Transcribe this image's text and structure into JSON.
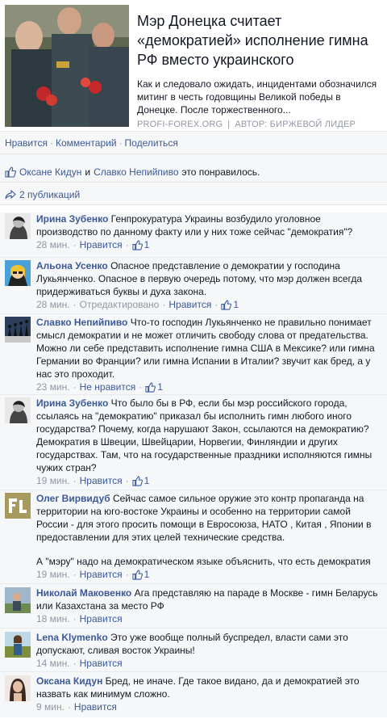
{
  "article": {
    "title": "Мэр Донецка считает «демократией» исполнение гимна РФ вместо украинского",
    "description": "Как и следовало ожидать, инцидентами обозначился митинг в честь годовщины Великой победы в Донецке. После торжественного...",
    "source": "PROFI-FOREX.ORG",
    "author": "АВТОР: БИРЖЕВОЙ ЛИДЕР"
  },
  "actions": {
    "like": "Нравится",
    "comment": "Комментарий",
    "share": "Поделиться"
  },
  "likes": {
    "user1": "Оксане Кидун",
    "conj": "и",
    "user2": "Славко Непийпиво",
    "suffix": "это понравилось."
  },
  "shares": {
    "label": "2 публикаций"
  },
  "comments": [
    {
      "author": "Ирина Зубенко",
      "text": "Генпрокуратура Украины возбудило уголовное производство по данному факту или у них тоже сейчас \"демократия\"?",
      "time": "28 мин.",
      "like_label": "Нравится",
      "likes": "1"
    },
    {
      "author": "Альона Усенко",
      "text": "Опасное представление о демократии у господина Лукьянченко. Опасное в первую очередь потому, что мэр должен всегда придерживаться буквы и духа закона.",
      "time": "28 мин.",
      "edited": "Отредактировано",
      "like_label": "Нравится",
      "likes": "1"
    },
    {
      "author": "Славко Непийпиво",
      "text": "Что-то господин Лукьянченко не правильно понимает смысл демократии и не может отличить свободу слова от предательства. Можно ли себе представить исполнение гимна США в Мексике? или гимна Германии во Франции? или гимна Испании в Италии? звучит как бред, а у нас это проходит.",
      "time": "23 мин.",
      "like_label": "Не нравится",
      "likes": "1"
    },
    {
      "author": "Ирина Зубенко",
      "text": "Что было бы в РФ, если бы мэр российского города, ссылаясь на \"демократию\" приказал бы исполнить гимн любого иного государства? Почему, когда нарушают Закон, ссылаются на демократию? Демократия в Швеции, Швейцарии, Норвегии, Финляндии и других государствах. Там, что на государственные праздники исполняются гимны чужих стран?",
      "time": "19 мин.",
      "like_label": "Нравится",
      "likes": "1"
    },
    {
      "author": "Олег Вирвидуб",
      "text": "Сейчас самое сильное оружие это контр пропаганда на территории на юго-востоке Украины и особенно на территории самой России - для этого просить помощи в Евросоюза, НАТО , Китая , Японии в предоставлении для этих целей технические средства.",
      "extra": "А \"мэру\" надо на демократическом языке объяснить, что есть демократия",
      "time": "19 мин.",
      "like_label": "Нравится",
      "likes": "1"
    },
    {
      "author": "Николай Маковенко",
      "text": "Ага представляю на параде в Москве - гимн Беларусь или Казахстана за место РФ",
      "time": "18 мин.",
      "like_label": "Нравится"
    },
    {
      "author": "Lena Klymenko",
      "text": "Это уже вообще полный буспредел, власти сами это допускают, сливая восток Украины!",
      "time": "14 мин.",
      "like_label": "Нравится"
    },
    {
      "author": "Оксана Кидун",
      "text": "Бред, не иначе. Где такое видано, да и демократией это назвать как минимум сложно.",
      "time": "9 мин.",
      "like_label": "Нравится"
    }
  ]
}
